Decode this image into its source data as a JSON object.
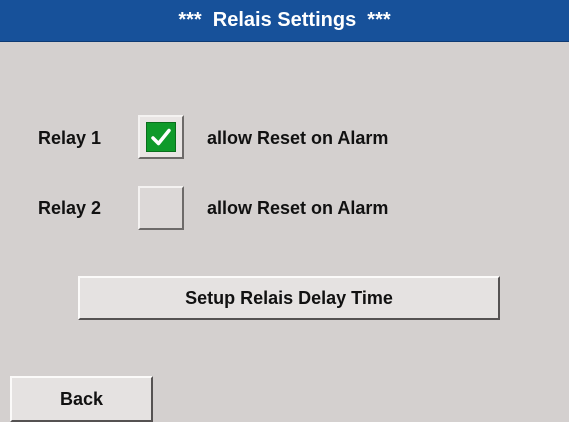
{
  "header": {
    "title": "***  Relais Settings  ***"
  },
  "relays": [
    {
      "label": "Relay 1",
      "checked": true,
      "reset_label": "allow Reset on Alarm"
    },
    {
      "label": "Relay 2",
      "checked": false,
      "reset_label": "allow Reset on Alarm"
    }
  ],
  "buttons": {
    "setup_delay": "Setup Relais Delay Time",
    "back": "Back"
  },
  "colors": {
    "title_bar": "#17519a",
    "background": "#d4d0cf",
    "check_green": "#0f9a2a"
  }
}
